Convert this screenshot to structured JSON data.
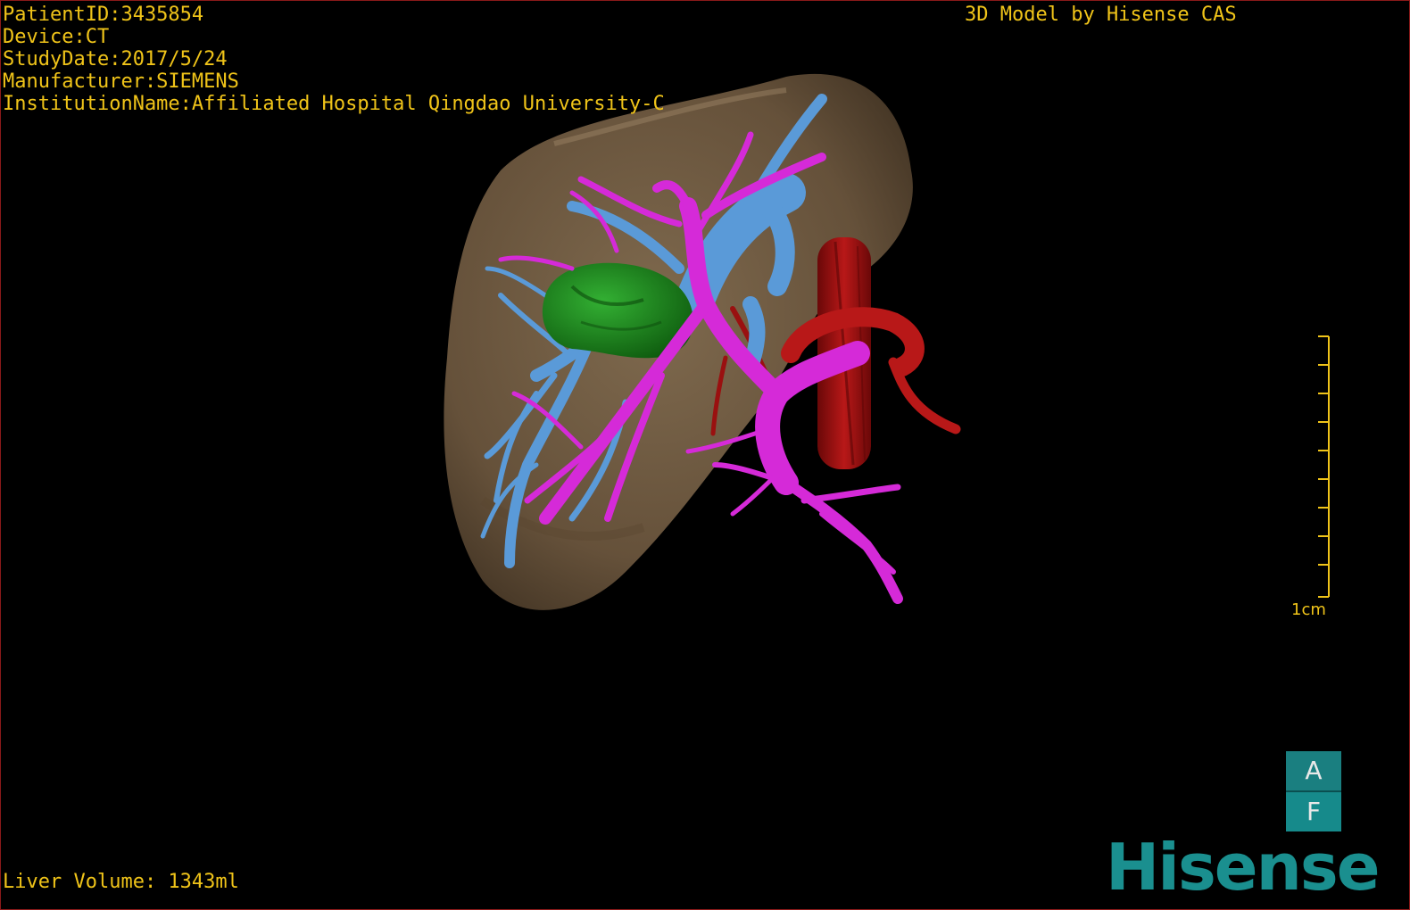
{
  "header": {
    "patient_id": "PatientID:3435854",
    "device": "Device:CT",
    "study_date": "StudyDate:2017/5/24",
    "manufacturer": "Manufacturer:SIEMENS",
    "institution": "InstitutionName:Affiliated Hospital Qingdao University-C",
    "credit": "3D Model by Hisense CAS"
  },
  "footer": {
    "liver_volume": "Liver Volume: 1343ml"
  },
  "scale": {
    "label": "1cm"
  },
  "orientation": {
    "top": "A",
    "bottom": "F"
  },
  "brand": "Hisense",
  "colors": {
    "text": "#f0c419",
    "liver": "#7a6348",
    "portal_vein": "#d52ad8",
    "hepatic_vein": "#5a9ad8",
    "tumor": "#1f8a1f",
    "artery": "#a01010",
    "logo": "#1a8f8f"
  }
}
